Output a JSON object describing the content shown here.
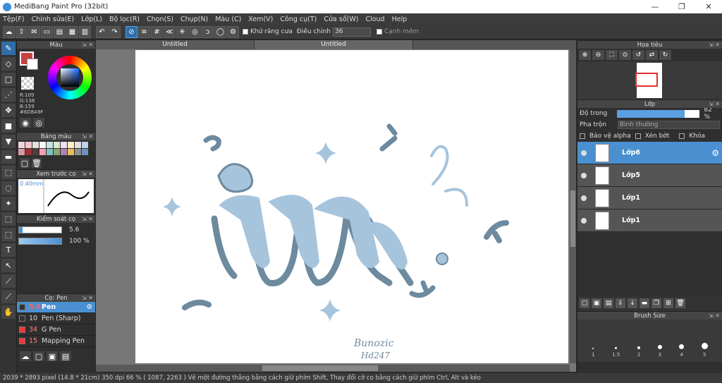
{
  "window": {
    "title": "MediBang Paint Pro (32bit)",
    "minimize": "—",
    "restore": "❐",
    "close": "✕"
  },
  "menu": [
    "Tệp(F)",
    "Chỉnh sửa(E)",
    "Lớp(L)",
    "Bộ lọc(R)",
    "Chọn(S)",
    "Chụp(N)",
    "Màu (C)",
    "Xem(V)",
    "Công cụ(T)",
    "Cửa sổ(W)",
    "Cloud",
    "Help"
  ],
  "toolbar": {
    "antialias_label": "Khử răng cưa",
    "adjust_label": "Điều chỉnh",
    "adjust_value": "36",
    "edge_label": "Cạnh mềm"
  },
  "tabs": [
    "Untitled",
    "Untitled"
  ],
  "left": {
    "color_title": "Màu",
    "rgb": {
      "r": "R:109",
      "g": "G:138",
      "b": "B:159",
      "hex": "#6D8A9F"
    },
    "palette_title": "Bảng màu",
    "brush_preview_title": "Xem trước cọ",
    "brush_preview_size": "0.40mm",
    "brush_control_title": "Kiểm soát cọ",
    "size_value": "5.6",
    "opacity_value": "100 %",
    "pens_title": "Cọ: Pen",
    "pens": [
      {
        "size": "5.6",
        "name": "Pen",
        "color": "#333333"
      },
      {
        "size": "10",
        "name": "Pen (Sharp)",
        "color": "#333333"
      },
      {
        "size": "34",
        "name": "G Pen",
        "color": "#ff3333"
      },
      {
        "size": "15",
        "name": "Mapping Pen",
        "color": "#ff3333"
      }
    ]
  },
  "right": {
    "navigator_title": "Họa tiêu",
    "layer_title": "Lớp",
    "opacity_label": "Độ trong",
    "opacity_value": "82 %",
    "blend_label": "Pha trộn",
    "blend_value": "Bình thường",
    "protect_alpha": "Bảo vệ alpha",
    "clipping": "Xén bớt",
    "lock": "Khóa",
    "layers": [
      "Lớp6",
      "Lớp5",
      "Lớp1",
      "Lớp1"
    ],
    "brush_size_title": "Brush Size",
    "brush_sizes": [
      "1",
      "1.5",
      "2",
      "3",
      "4",
      "5"
    ]
  },
  "canvas": {
    "signature_line1": "Bunozic",
    "signature_line2": "Hd247"
  },
  "status": {
    "text": "2039 * 2893 pixel   (14.8 * 21cm)   350 dpi   66 %   ( 1087, 2263 )   Vẽ một đường thẳng bằng cách giữ phím Shift, Thay đổi cỡ cọ bằng cách giữ phím Ctrl, Alt và kéo"
  },
  "colors": {
    "accent": "#4a90d0",
    "ink": "#6d8a9f",
    "light": "#a7c4dd"
  }
}
